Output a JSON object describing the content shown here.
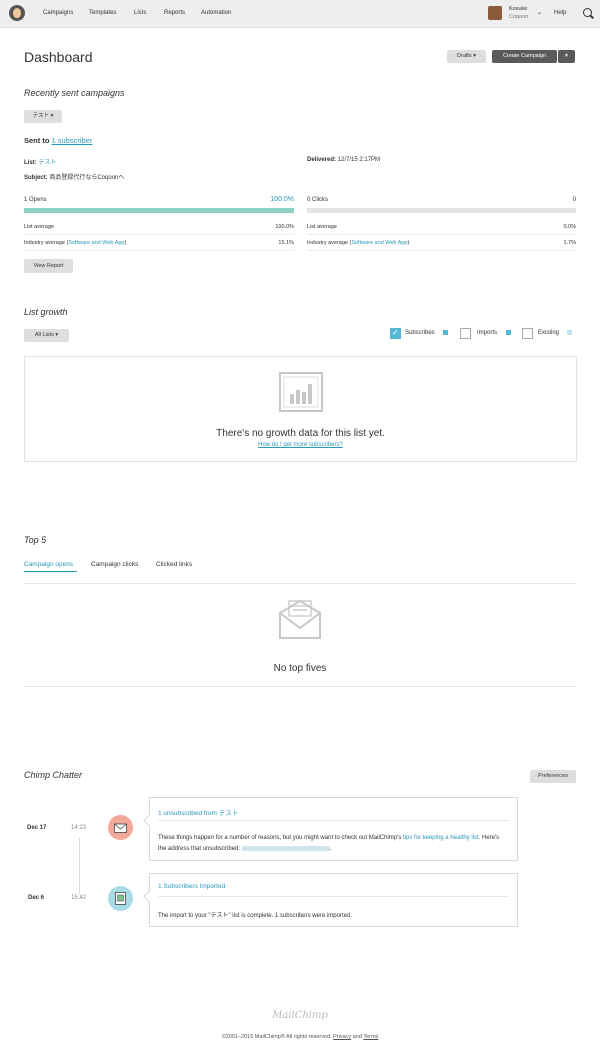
{
  "nav": {
    "items": [
      "Campaigns",
      "Templates",
      "Lists",
      "Reports",
      "Automation"
    ],
    "user_name": "Kosuke",
    "user_org": "Coqoon",
    "help": "Help"
  },
  "header": {
    "title": "Dashboard",
    "drafts_label": "Drafts",
    "create_label": "Create Campaign"
  },
  "recent": {
    "title": "Recently sent campaigns",
    "dropdown": "テスト",
    "sent_to_prefix": "Sent to ",
    "sent_to_link": "1 subscriber",
    "list_label": "List:",
    "list_value": "テスト",
    "subject_label": "Subject:",
    "subject_value": "商品登録代行ならCoqoonへ",
    "delivered_label": "Delivered:",
    "delivered_value": "12/7/15 2:17PM",
    "opens": {
      "label": "1 Opens",
      "percent": "100.0%",
      "fill_fraction": 1.0,
      "list_avg_label": "List average",
      "list_avg_value": "100.0%",
      "industry_label": "Industry average (",
      "industry_link": "Software and Web App",
      "industry_close": ")",
      "industry_value": "15.1%"
    },
    "clicks": {
      "label": "0 Clicks",
      "value": "0",
      "fill_fraction": 0.0,
      "list_avg_label": "List average",
      "list_avg_value": "0.0%",
      "industry_label": "Industry average (",
      "industry_link": "Software and Web App",
      "industry_close": ")",
      "industry_value": "1.7%"
    },
    "view_report": "View Report"
  },
  "growth": {
    "title": "List growth",
    "dropdown": "All Lists",
    "legend": [
      {
        "label": "Subscribes",
        "checked": true,
        "color": "#52bad5"
      },
      {
        "label": "Imports",
        "checked": false,
        "color": "#52bad5"
      },
      {
        "label": "Existing",
        "checked": false,
        "color": "#bfe3ee"
      }
    ],
    "empty_title": "There's no growth data for this list yet.",
    "empty_link": "How do I get more subscribers?"
  },
  "top5": {
    "title": "Top 5",
    "tabs": [
      "Campaign opens",
      "Campaign clicks",
      "Clicked links"
    ],
    "empty_title": "No top fives"
  },
  "chatter": {
    "title": "Chimp Chatter",
    "preferences": "Preferences",
    "items": [
      {
        "date": "Dec 17",
        "time": "14:23",
        "icon_color": "#f3a99a",
        "title_prefix": "1 unsubscribed from ",
        "title_link": "テスト",
        "body_1": "These things happen for a number of reasons, but you might want to check out MailChimp's ",
        "body_link": "tips for keeping a healthy list",
        "body_2": ". Here's the address that unsubscribed: "
      },
      {
        "date": "Dec 6",
        "time": "15:42",
        "icon_color": "#a7dbe6",
        "title": "1 Subscribers Imported",
        "body": "The import to your \"テスト\" list is complete. 1 subscribers were imported."
      }
    ]
  },
  "footer": {
    "brand": "MailChimp",
    "copyright": "©2001–2015 MailChimp® All rights reserved.",
    "privacy": "Privacy",
    "and": "and",
    "terms": "Terms"
  }
}
